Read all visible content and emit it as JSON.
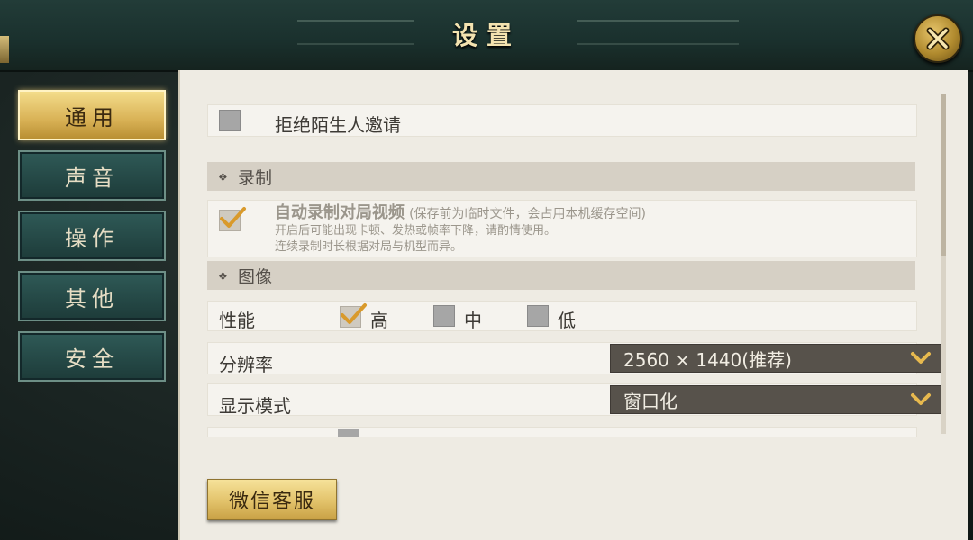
{
  "header": {
    "title": "设置"
  },
  "sidebar": {
    "tabs": [
      {
        "label": "通用",
        "active": true
      },
      {
        "label": "声音",
        "active": false
      },
      {
        "label": "操作",
        "active": false
      },
      {
        "label": "其他",
        "active": false
      },
      {
        "label": "安全",
        "active": false
      }
    ]
  },
  "general": {
    "reject_invite": {
      "label": "拒绝陌生人邀请",
      "checked": false
    },
    "recording": {
      "section_title": "录制",
      "auto_record": {
        "label": "自动录制对局视频",
        "note": "(保存前为临时文件，会占用本机缓存空间)",
        "desc_line1": "开启后可能出现卡顿、发热或帧率下降，请酌情使用。",
        "desc_line2": "连续录制时长根据对局与机型而异。",
        "checked": true
      }
    },
    "graphics": {
      "section_title": "图像",
      "performance": {
        "label": "性能",
        "options": [
          {
            "label": "高",
            "checked": true
          },
          {
            "label": "中",
            "checked": false
          },
          {
            "label": "低",
            "checked": false
          }
        ]
      },
      "resolution": {
        "label": "分辨率",
        "value": "2560 × 1440(推荐)"
      },
      "display_mode": {
        "label": "显示模式",
        "value": "窗口化"
      }
    }
  },
  "footer": {
    "wechat_button": "微信客服"
  },
  "colors": {
    "accent_gold": "#d9b256",
    "panel_bg": "#eeebe3",
    "tab_teal": "#2f5a57"
  }
}
